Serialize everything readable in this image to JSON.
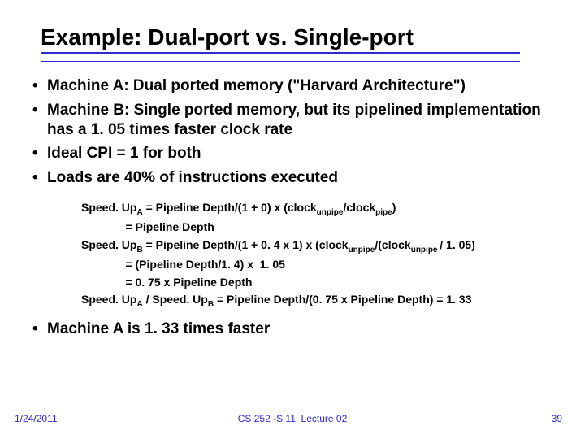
{
  "title": "Example: Dual-port vs. Single-port",
  "bullets": {
    "b1": "Machine A: Dual ported memory (\"Harvard Architecture\")",
    "b2": "Machine B: Single ported memory, but its pipelined implementation has a 1. 05 times faster clock rate",
    "b3": "Ideal CPI = 1 for both",
    "b4": "Loads are 40% of instructions executed",
    "b5": "Machine A is 1. 33 times faster"
  },
  "eq": {
    "l1a": "Speed. Up",
    "l1sub": "A",
    "l1b": " = Pipeline Depth/(1 + 0) x (clock",
    "l1sub2": "unpipe",
    "l1c": "/clock",
    "l1sub3": "pipe",
    "l1d": ")",
    "l2": "              = Pipeline Depth",
    "l3a": "Speed. Up",
    "l3sub": "B",
    "l3b": " = Pipeline Depth/(1 + 0. 4 x 1) x (clock",
    "l3sub2": "unpipe",
    "l3c": "/(clock",
    "l3sub3": "unpipe ",
    "l3d": "/ 1. 05)",
    "l4": "              = (Pipeline Depth/1. 4) x  1. 05",
    "l5": "              = 0. 75 x Pipeline Depth",
    "l6a": "Speed. Up",
    "l6sub1": "A",
    "l6b": " / Speed. Up",
    "l6sub2": "B",
    "l6c": " = Pipeline Depth/(0. 75 x Pipeline Depth) = 1. 33"
  },
  "footer": {
    "date": "1/24/2011",
    "course": "CS 252 -S 11, Lecture 02",
    "page": "39"
  }
}
